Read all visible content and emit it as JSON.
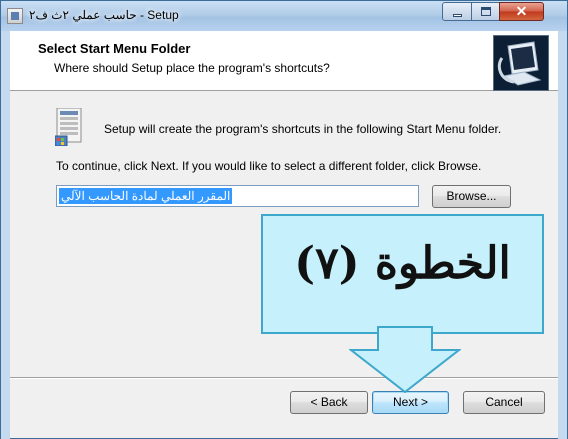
{
  "window": {
    "title": "حاسب عملي ٢ث ف٢ - Setup",
    "controls": {
      "minimize": "minimize",
      "maximize": "maximize",
      "close": "✕"
    }
  },
  "header": {
    "title": "Select Start Menu Folder",
    "subtitle": "Where should Setup place the program's shortcuts?",
    "image": "computer-setup-icon"
  },
  "body": {
    "description": "Setup will create the program's shortcuts in the following Start Menu folder.",
    "instruction": "To continue, click Next. If you would like to select a different folder, click Browse.",
    "folder_value": "المقرر العملي لمادة الحاسب الآلي",
    "browse_label": "Browse...",
    "folder_icon": "start-menu-folder-icon"
  },
  "footer": {
    "back_label": "< Back",
    "next_label": "Next >",
    "cancel_label": "Cancel"
  },
  "callout": {
    "text": "الخطوة (٧)"
  },
  "colors": {
    "callout_fill": "#c6f0fb",
    "callout_border": "#3ea7cc",
    "selection": "#3399ff"
  }
}
